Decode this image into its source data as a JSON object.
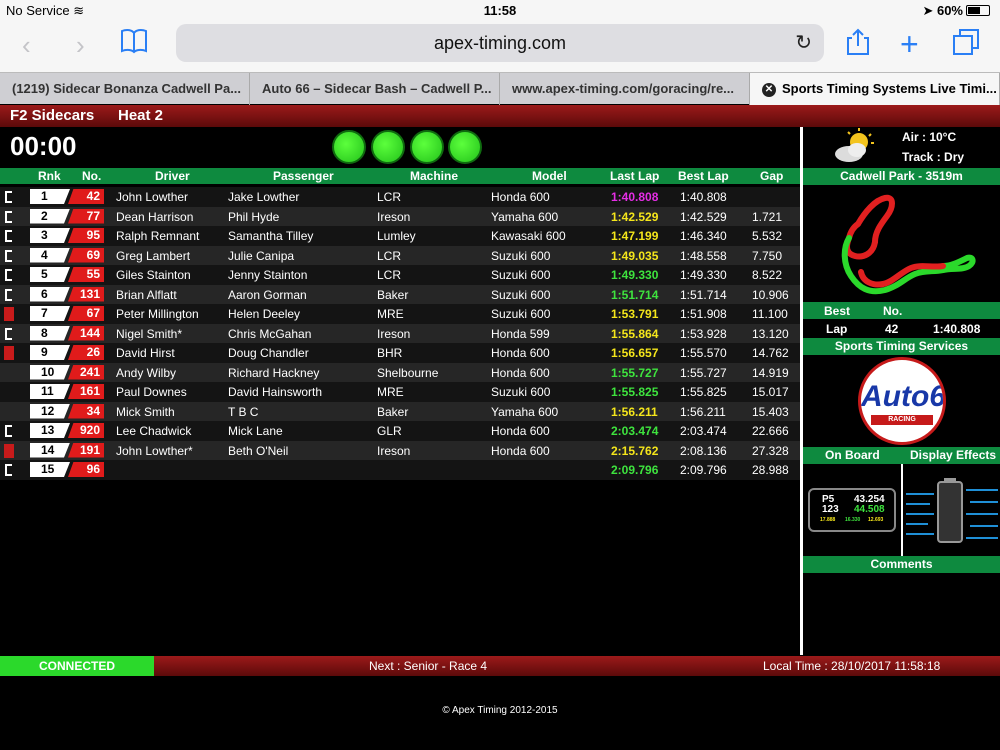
{
  "status": {
    "carrier": "No Service",
    "time": "11:58",
    "battery": "60%"
  },
  "browser": {
    "url": "apex-timing.com"
  },
  "tabs": [
    {
      "label": "(1219) Sidecar Bonanza Cadwell Pa..."
    },
    {
      "label": "Auto 66 – Sidecar Bash – Cadwell P..."
    },
    {
      "label": "www.apex-timing.com/goracing/re..."
    },
    {
      "label": "Sports Timing Systems Live Timi..."
    }
  ],
  "race": {
    "class": "F2 Sidecars",
    "heat": "Heat 2",
    "clock": "00:00"
  },
  "columns": {
    "rnk": "Rnk",
    "no": "No.",
    "driver": "Driver",
    "passenger": "Passenger",
    "machine": "Machine",
    "model": "Model",
    "last": "Last Lap",
    "best": "Best Lap",
    "gap": "Gap"
  },
  "rows": [
    {
      "rnk": "1",
      "no": "42",
      "driver": "John Lowther",
      "passenger": "Jake Lowther",
      "machine": "LCR",
      "model": "Honda 600",
      "last": "1:40.808",
      "best": "1:40.808",
      "gap": "",
      "lastColor": "purple",
      "flag": "bracket"
    },
    {
      "rnk": "2",
      "no": "77",
      "driver": "Dean Harrison",
      "passenger": "Phil Hyde",
      "machine": "Ireson",
      "model": "Yamaha 600",
      "last": "1:42.529",
      "best": "1:42.529",
      "gap": "1.721",
      "lastColor": "yellow",
      "flag": "bracket"
    },
    {
      "rnk": "3",
      "no": "95",
      "driver": "Ralph Remnant",
      "passenger": "Samantha Tilley",
      "machine": "Lumley",
      "model": "Kawasaki 600",
      "last": "1:47.199",
      "best": "1:46.340",
      "gap": "5.532",
      "lastColor": "yellow",
      "flag": "bracket"
    },
    {
      "rnk": "4",
      "no": "69",
      "driver": "Greg Lambert",
      "passenger": "Julie Canipa",
      "machine": "LCR",
      "model": "Suzuki 600",
      "last": "1:49.035",
      "best": "1:48.558",
      "gap": "7.750",
      "lastColor": "yellow",
      "flag": "bracket"
    },
    {
      "rnk": "5",
      "no": "55",
      "driver": "Giles Stainton",
      "passenger": "Jenny Stainton",
      "machine": "LCR",
      "model": "Suzuki 600",
      "last": "1:49.330",
      "best": "1:49.330",
      "gap": "8.522",
      "lastColor": "green",
      "flag": "bracket"
    },
    {
      "rnk": "6",
      "no": "131",
      "driver": "Brian Alflatt",
      "passenger": "Aaron Gorman",
      "machine": "Baker",
      "model": "Suzuki 600",
      "last": "1:51.714",
      "best": "1:51.714",
      "gap": "10.906",
      "lastColor": "green",
      "flag": "bracket"
    },
    {
      "rnk": "7",
      "no": "67",
      "driver": "Peter Millington",
      "passenger": "Helen Deeley",
      "machine": "MRE",
      "model": "Suzuki 600",
      "last": "1:53.791",
      "best": "1:51.908",
      "gap": "11.100",
      "lastColor": "yellow",
      "flag": "tn"
    },
    {
      "rnk": "8",
      "no": "144",
      "driver": "Nigel Smith*",
      "passenger": "Chris McGahan",
      "machine": "Ireson",
      "model": "Honda 599",
      "last": "1:55.864",
      "best": "1:53.928",
      "gap": "13.120",
      "lastColor": "yellow",
      "flag": "bracket"
    },
    {
      "rnk": "9",
      "no": "26",
      "driver": "David Hirst",
      "passenger": "Doug Chandler",
      "machine": "BHR",
      "model": "Honda 600",
      "last": "1:56.657",
      "best": "1:55.570",
      "gap": "14.762",
      "lastColor": "yellow",
      "flag": "tn"
    },
    {
      "rnk": "10",
      "no": "241",
      "driver": "Andy Wilby",
      "passenger": "Richard Hackney",
      "machine": "Shelbourne",
      "model": "Honda 600",
      "last": "1:55.727",
      "best": "1:55.727",
      "gap": "14.919",
      "lastColor": "green",
      "flag": "none"
    },
    {
      "rnk": "11",
      "no": "161",
      "driver": "Paul Downes",
      "passenger": "David Hainsworth",
      "machine": "MRE",
      "model": "Suzuki 600",
      "last": "1:55.825",
      "best": "1:55.825",
      "gap": "15.017",
      "lastColor": "green",
      "flag": "none"
    },
    {
      "rnk": "12",
      "no": "34",
      "driver": "Mick Smith",
      "passenger": "T B C",
      "machine": "Baker",
      "model": "Yamaha 600",
      "last": "1:56.211",
      "best": "1:56.211",
      "gap": "15.403",
      "lastColor": "yellow",
      "flag": "none"
    },
    {
      "rnk": "13",
      "no": "920",
      "driver": "Lee Chadwick",
      "passenger": "Mick Lane",
      "machine": "GLR",
      "model": "Honda 600",
      "last": "2:03.474",
      "best": "2:03.474",
      "gap": "22.666",
      "lastColor": "green",
      "flag": "bracket"
    },
    {
      "rnk": "14",
      "no": "191",
      "driver": "John Lowther*",
      "passenger": "Beth O'Neil",
      "machine": "Ireson",
      "model": "Honda 600",
      "last": "2:15.762",
      "best": "2:08.136",
      "gap": "27.328",
      "lastColor": "yellow",
      "flag": "tn"
    },
    {
      "rnk": "15",
      "no": "96",
      "driver": "",
      "passenger": "",
      "machine": "",
      "model": "",
      "last": "2:09.796",
      "best": "2:09.796",
      "gap": "28.988",
      "lastColor": "green",
      "flag": "bracket"
    }
  ],
  "weather": {
    "air": "Air : 10°C",
    "track": "Track : Dry"
  },
  "circuit": "Cadwell Park - 3519m",
  "best": {
    "label_best": "Best",
    "label_no": "No.",
    "label_lap": "Lap",
    "no": "42",
    "time": "1:40.808"
  },
  "sponsor": {
    "title": "Sports Timing Services",
    "logo": "Auto66",
    "logo_sub": "RACING"
  },
  "onboard": {
    "title": "On Board",
    "p": "P5",
    "car": "123",
    "t1": "43.254",
    "t2": "44.508",
    "s1": "17.888",
    "s2": "16.330",
    "s3": "12.693"
  },
  "effects": {
    "title": "Display Effects"
  },
  "comments": {
    "title": "Comments"
  },
  "footer": {
    "connected": "CONNECTED",
    "next": "Next : Senior - Race 4",
    "local": "Local Time : 28/10/2017 11:58:18",
    "copyright": "© Apex Timing 2012-2015"
  }
}
